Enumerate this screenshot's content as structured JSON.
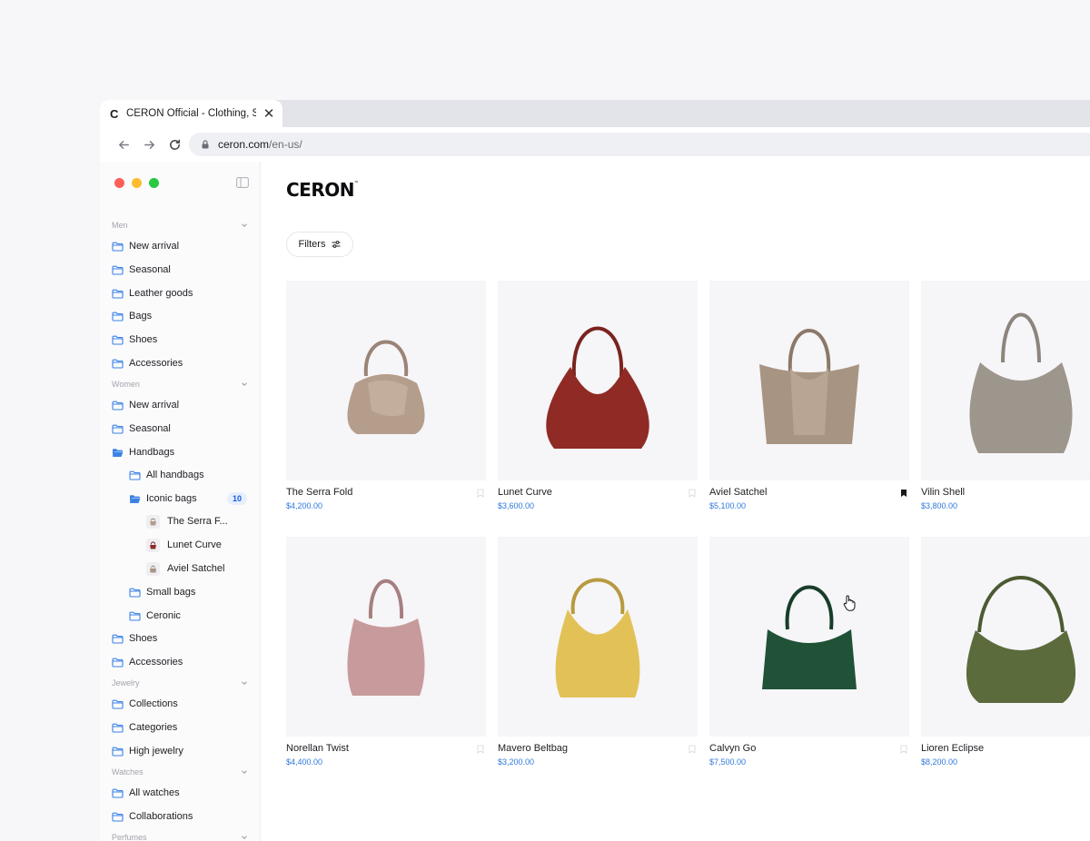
{
  "browser": {
    "tab_title": "CERON Official - Clothing, Shoes & Accessories",
    "tab_favicon": "C",
    "url_domain": "ceron.com",
    "url_path": "/en-us/"
  },
  "sidebar": {
    "sections": [
      {
        "label": "Men"
      },
      {
        "label": "Women"
      },
      {
        "label": "Jewelry"
      },
      {
        "label": "Watches"
      },
      {
        "label": "Perfumes"
      }
    ],
    "men": [
      "New arrival",
      "Seasonal",
      "Leather goods",
      "Bags",
      "Shoes",
      "Accessories"
    ],
    "women": [
      "New arrival",
      "Seasonal",
      "Handbags"
    ],
    "handbags": [
      "All handbags",
      "Iconic bags"
    ],
    "iconic_count": "10",
    "iconic_items": [
      "The Serra F...",
      "Lunet Curve",
      "Aviel Satchel"
    ],
    "handbags_more": [
      "Small bags",
      "Ceronic"
    ],
    "women_more": [
      "Shoes",
      "Accessories"
    ],
    "jewelry": [
      "Collections",
      "Categories",
      "High jewelry"
    ],
    "watches": [
      "All watches",
      "Collaborations"
    ]
  },
  "main": {
    "logo": "CERON",
    "logo_tm": "™",
    "filters_label": "Filters"
  },
  "products": [
    {
      "name": "The Serra Fold",
      "price": "$4,200.00",
      "color": "#b59d8c"
    },
    {
      "name": "Lunet Curve",
      "price": "$3,600.00",
      "color": "#8f2a25"
    },
    {
      "name": "Aviel Satchel",
      "price": "$5,100.00",
      "color": "#a89482"
    },
    {
      "name": "Vilin Shell",
      "price": "$3,800.00",
      "color": "#9d968c"
    },
    {
      "name": "Norellan Twist",
      "price": "$4,400.00",
      "color": "#c79b9c"
    },
    {
      "name": "Mavero Beltbag",
      "price": "$3,200.00",
      "color": "#e2c257"
    },
    {
      "name": "Calvyn Go",
      "price": "$7,500.00",
      "color": "#1f5237"
    },
    {
      "name": "Lioren Eclipse",
      "price": "$8,200.00",
      "color": "#5b6b3c"
    }
  ],
  "colors": {
    "accent": "#2f79dc",
    "folder": "#3b82e6",
    "traffic_red": "#fe5f57",
    "traffic_yellow": "#febc2e",
    "traffic_green": "#28c840"
  }
}
